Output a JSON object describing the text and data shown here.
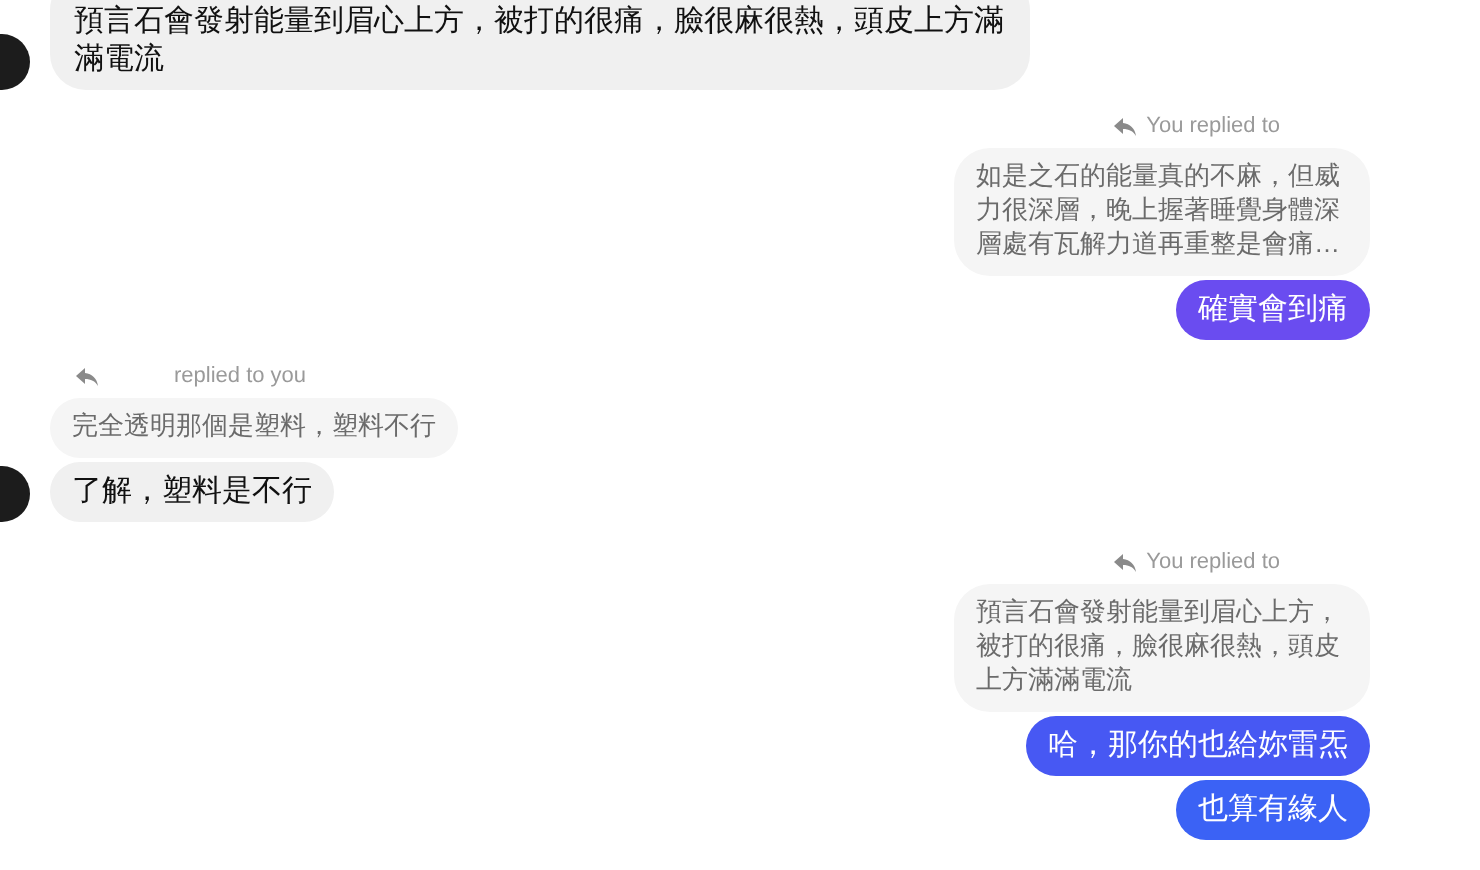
{
  "messages": [
    {
      "kind": "incoming",
      "avatar": true,
      "text": "預言石會發射能量到眉心上方，被打的很痛，臉很麻很熱，頭皮上方滿滿電流"
    },
    {
      "kind": "outgoing_reply",
      "reply_label": "You replied to",
      "quoted": "如是之石的能量真的不麻，但威力很深層，晚上握著睡覺身體深層處有瓦解力道再重整是會痛…",
      "bubbles": [
        {
          "text": "確實會到痛",
          "color": "#6a4cf0"
        }
      ]
    },
    {
      "kind": "incoming_reply",
      "reply_label": "replied to you",
      "quoted": "完全透明那個是塑料，塑料不行",
      "avatar": true,
      "bubbles": [
        {
          "text": "了解，塑料是不行"
        }
      ]
    },
    {
      "kind": "outgoing_reply",
      "reply_label": "You replied to",
      "quoted": "預言石會發射能量到眉心上方，被打的很痛，臉很麻很熱，頭皮上方滿滿電流",
      "bubbles": [
        {
          "text": "哈，那你的也給妳雷炁",
          "color": "#4758f3"
        },
        {
          "text": "也算有緣人",
          "color": "#3b62f5"
        }
      ]
    }
  ]
}
